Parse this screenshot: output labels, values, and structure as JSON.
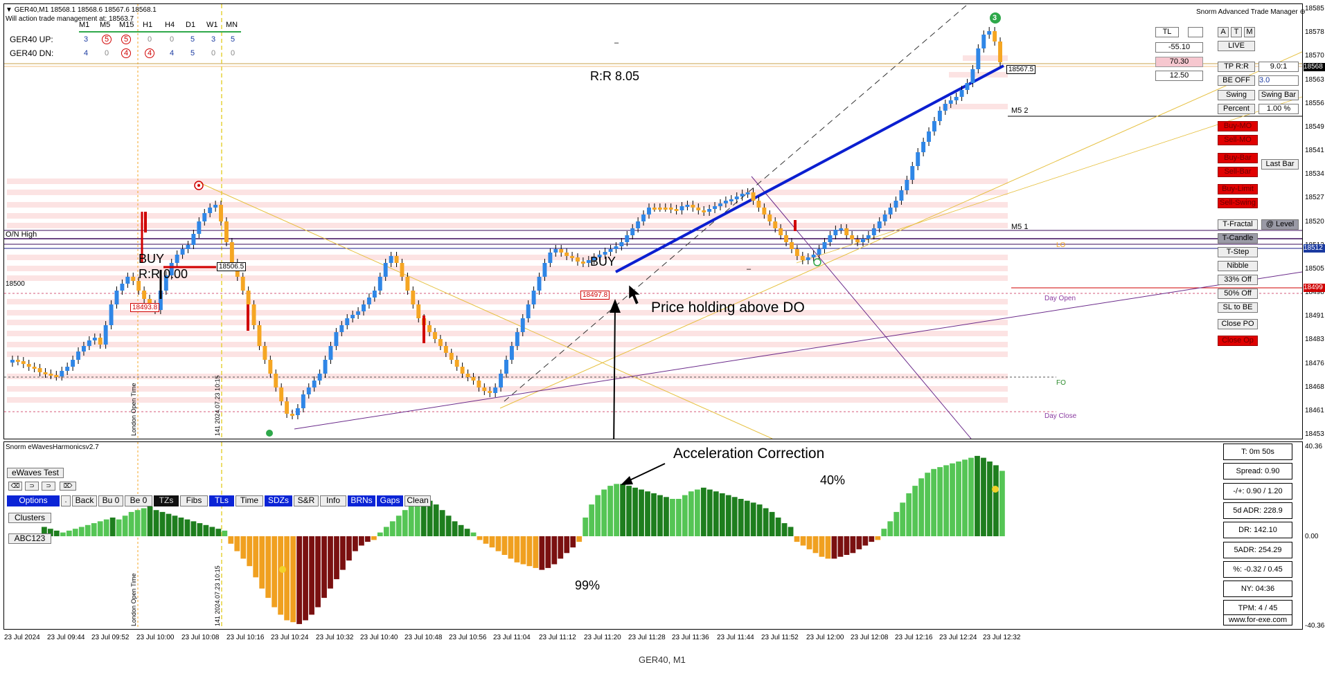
{
  "header": {
    "symbol_line": "GER40,M1  18568.1 18568.6 18567.6 18568.1",
    "action_line": "Will action trade management at: 18563.7",
    "manager_title": "Snorm Advanced Trade Manager"
  },
  "mtf_table": {
    "timeframes": [
      "M1",
      "M5",
      "M15",
      "H1",
      "H4",
      "D1",
      "W1",
      "MN"
    ],
    "rows": [
      {
        "label": "GER40 UP:",
        "values": [
          "3",
          "5",
          "5",
          "0",
          "0",
          "5",
          "3",
          "5"
        ],
        "circled": [
          false,
          true,
          true,
          false,
          false,
          false,
          false,
          false
        ]
      },
      {
        "label": "GER40 DN:",
        "values": [
          "4",
          "0",
          "4",
          "4",
          "4",
          "5",
          "0",
          "0"
        ],
        "circled": [
          false,
          false,
          true,
          true,
          false,
          false,
          false,
          false
        ]
      }
    ]
  },
  "price_axis": {
    "labels": [
      "18585",
      "18578",
      "18570",
      "18563",
      "18556",
      "18549",
      "18541",
      "18534",
      "18527",
      "18520",
      "18512",
      "18505",
      "18498",
      "18491",
      "18483",
      "18476",
      "18468",
      "18461",
      "18453"
    ],
    "current_price_tag": "18568",
    "mid_tag": "18512",
    "red_tag": "18499"
  },
  "indicator_axis": {
    "top": "40.36",
    "zero": "0.00",
    "bottom": "-40.36"
  },
  "chart_annotations": {
    "on_high": "O/N High",
    "level_18500": "18500",
    "rr_main": "R:R 8.05",
    "buy_left": "BUY",
    "rr_left": "R:R 0.00",
    "buy_right": "BUY",
    "price_holding": "Price holding above DO",
    "accel_correction": "Acceleration Correction",
    "pct_40": "40%",
    "pct_99": "99%",
    "m5_2": "M5 2",
    "m5_1": "M5 1",
    "day_open": "Day Open",
    "day_close": "Day Close",
    "fo": "FO",
    "lo": "LO",
    "tag_18506": "18506.5",
    "tag_18493": "18493.8",
    "tag_18497": "18497.8",
    "tag_18567": "18567.5",
    "london_open": "London Open Time",
    "time_1015": "141 2024.07.23 10:15",
    "circle_num_top": "3",
    "dash_mark": "–"
  },
  "trade_panel": {
    "tl": "TL",
    "blank": "",
    "a": "A",
    "t": "T",
    "m": "M",
    "live": "LIVE",
    "value_neg": "-55.10",
    "value_pink": "70.30",
    "value_12": "12.50",
    "tp_rr": "TP R:R",
    "tp_rr_val": "9.0:1",
    "be_off": "BE OFF",
    "be_val": "3.0",
    "swing": "Swing",
    "swing_bar": "Swing Bar",
    "percent": "Percent",
    "percent_val": "1.00 %",
    "buy_mo": "Buy-MO",
    "sell_mo": "Sell-MO",
    "buy_bar": "Buy-Bar",
    "sell_bar": "Sell-Bar",
    "last_bar": "Last Bar",
    "buy_limit": "Buy-Limit",
    "sell_swing": "Sell-Swing",
    "t_fractal": "T-Fractal",
    "at_level": "@ Level",
    "t_candle": "T-Candle",
    "t_step": "T-Step",
    "nibble": "Nibble",
    "off33": "33% Off",
    "off50": "50% Off",
    "sl_to_be": "SL to BE",
    "close_po": "Close PO",
    "close_op": "Close Op"
  },
  "indicator": {
    "title": "Snorm eWavesHarmonicsv2.7",
    "ewaves_test": "eWaves Test",
    "small_btns": [
      "⌫",
      "⊃",
      "⊃",
      "⌦"
    ],
    "options": "Options",
    "dot": ".",
    "back": "Back",
    "bu0": "Bu 0",
    "be0": "Be 0",
    "tzs": "TZs",
    "fibs": "Fibs",
    "tls": "TLs",
    "time": "Time",
    "sdzs": "SDZs",
    "sr": "S&R",
    "info": "Info",
    "brns": "BRNs",
    "gaps": "Gaps",
    "clean": "Clean",
    "clusters": "Clusters",
    "abc123": "ABC123"
  },
  "stats": [
    "T: 0m 50s",
    "Spread: 0.90",
    "-/+: 0.90 / 1.20",
    "5d ADR: 228.9",
    "DR: 142.10",
    "5ADR: 254.29",
    "%: -0.32 / 0.45",
    "NY: 04:36",
    "TPM: 4 / 45",
    "www.for-exe.com"
  ],
  "x_axis": [
    "23 Jul 2024",
    "23 Jul 09:44",
    "23 Jul 09:52",
    "23 Jul 10:00",
    "23 Jul 10:08",
    "23 Jul 10:16",
    "23 Jul 10:24",
    "23 Jul 10:32",
    "23 Jul 10:40",
    "23 Jul 10:48",
    "23 Jul 10:56",
    "23 Jul 11:04",
    "23 Jul 11:12",
    "23 Jul 11:20",
    "23 Jul 11:28",
    "23 Jul 11:36",
    "23 Jul 11:44",
    "23 Jul 11:52",
    "23 Jul 12:00",
    "23 Jul 12:08",
    "23 Jul 12:16",
    "23 Jul 12:24",
    "23 Jul 12:32"
  ],
  "footer": "GER40, M1",
  "colors": {
    "bull": "#2f86e6",
    "bear": "#f5a623",
    "bull_hist": "#2e9e2e",
    "bear_hist": "#8b1a1a",
    "orange_hist": "#f0a020",
    "trend": "#0b1fd0"
  }
}
